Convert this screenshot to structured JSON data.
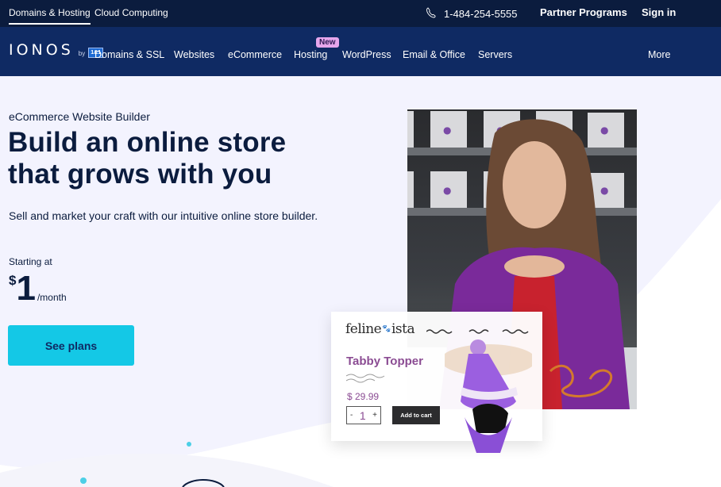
{
  "topbar": {
    "tabs": [
      {
        "label": "Domains & Hosting",
        "active": true
      },
      {
        "label": "Cloud Computing",
        "active": false
      }
    ],
    "phone_icon": "phone-icon",
    "phone": "1-484-254-5555",
    "partner_programs": "Partner Programs",
    "sign_in": "Sign in"
  },
  "nav": {
    "logo": {
      "word": "IONOS",
      "by": "by",
      "badge": "1&1"
    },
    "items": [
      {
        "label": "Domains & SSL"
      },
      {
        "label": "Websites"
      },
      {
        "label": "eCommerce"
      },
      {
        "label": "Hosting",
        "badge": "New"
      },
      {
        "label": "WordPress"
      },
      {
        "label": "Email & Office"
      },
      {
        "label": "Servers"
      }
    ],
    "more": "More"
  },
  "hero": {
    "eyebrow": "eCommerce Website Builder",
    "headline_line1": "Build an online store",
    "headline_line2": "that grows with you",
    "subtext": "Sell and market your craft with our intuitive online store builder.",
    "starting_at": "Starting at",
    "price_currency": "$",
    "price_amount": "1",
    "price_period": "/month",
    "cta": "See plans"
  },
  "product_card": {
    "brand_left": "feline",
    "brand_paw": "paw-icon",
    "brand_right": "ista",
    "product_name": "Tabby Topper",
    "price": "$ 29.99",
    "qty_minus": "-",
    "qty_value": "1",
    "qty_plus": "+",
    "add_to_cart": "Add to cart"
  },
  "colors": {
    "topbar_bg": "#0b1c3e",
    "nav_bg": "#0f2a63",
    "hero_bg": "#f3f3fe",
    "cta_bg": "#14c8e6",
    "new_badge_bg": "#e6a6ec",
    "product_accent": "#8b4c93"
  }
}
